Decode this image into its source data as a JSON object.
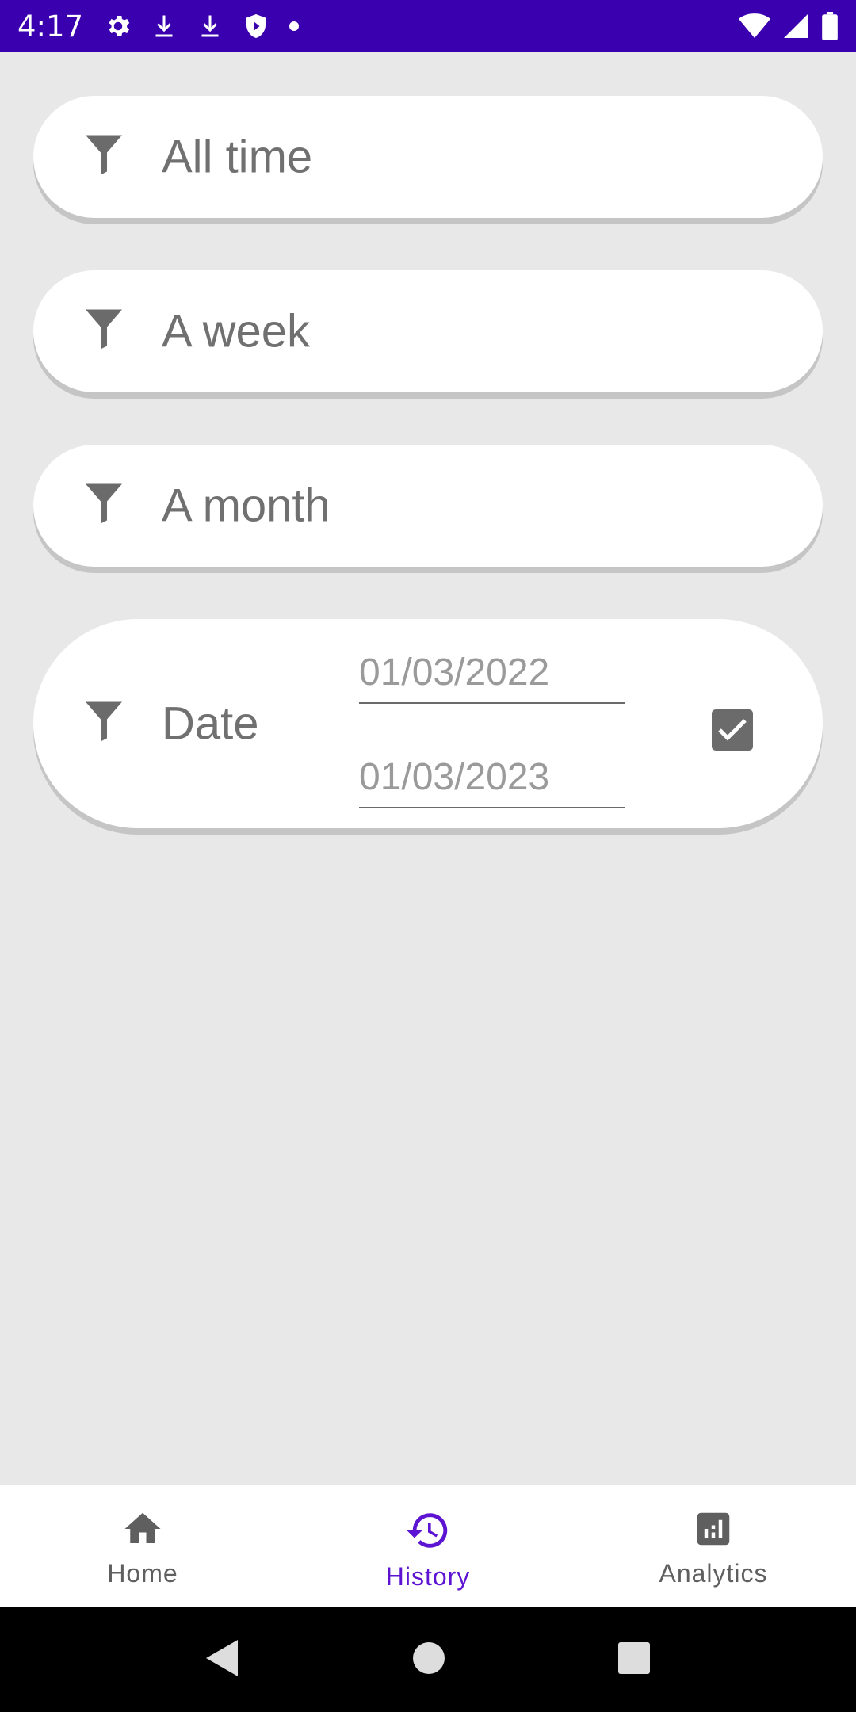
{
  "status_bar": {
    "time": "4:17",
    "left_icons": [
      "settings-icon",
      "download-icon",
      "download-icon",
      "shield-icon",
      "dot-icon"
    ],
    "right_icons": [
      "wifi-icon",
      "signal-icon",
      "battery-icon"
    ],
    "background": "#3a00b0"
  },
  "filters": {
    "all_time": "All time",
    "week": "A week",
    "month": "A month",
    "date": {
      "label": "Date",
      "from": "01/03/2022",
      "to": "01/03/2023",
      "checked": true
    }
  },
  "bottom_nav": {
    "items": [
      {
        "label": "Home",
        "icon": "home-icon",
        "active": false
      },
      {
        "label": "History",
        "icon": "history-icon",
        "active": true
      },
      {
        "label": "Analytics",
        "icon": "analytics-icon",
        "active": false
      }
    ],
    "active_color": "#5d14d2",
    "inactive_color": "#5f5f5f"
  },
  "system_nav": [
    "back-icon",
    "home-circle-icon",
    "recents-icon"
  ]
}
